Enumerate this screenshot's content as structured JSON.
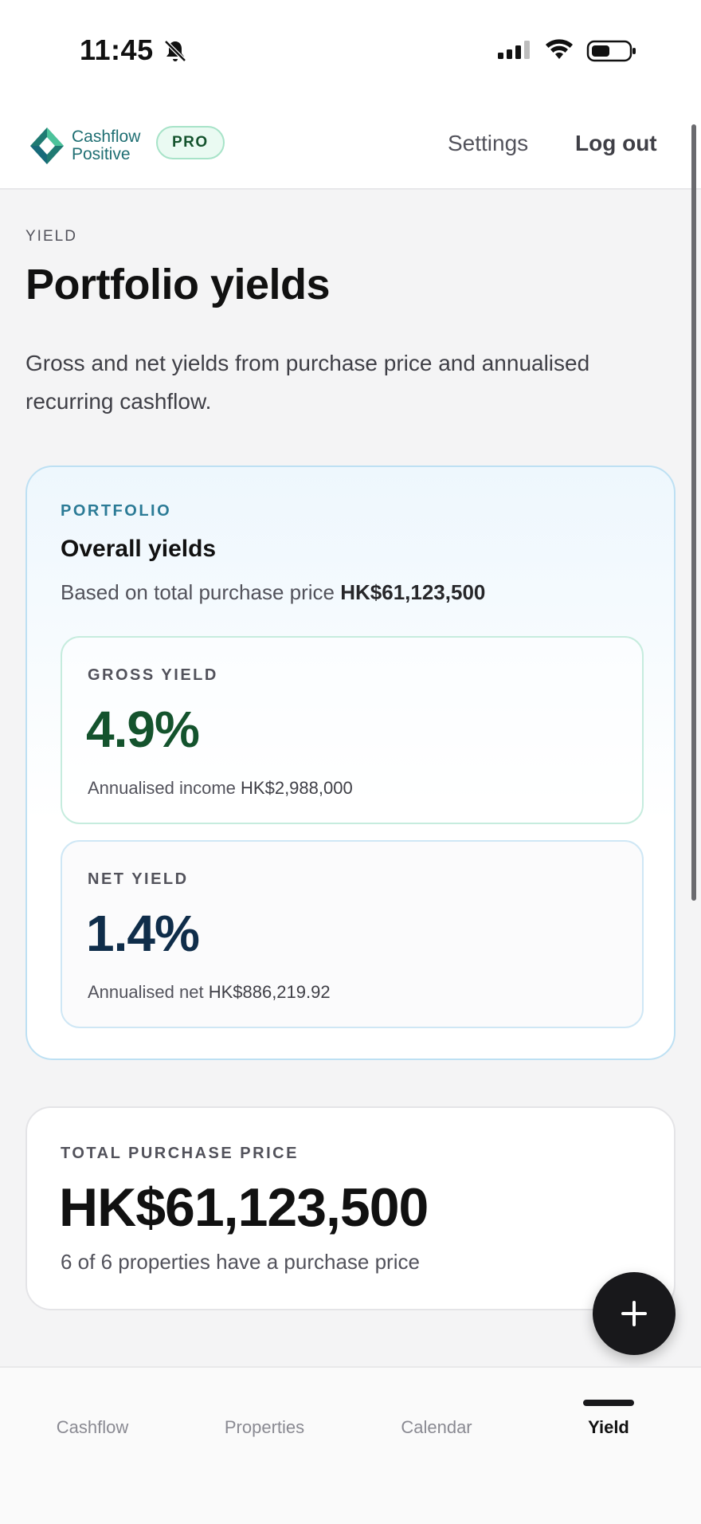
{
  "status_bar": {
    "time": "11:45",
    "icons": [
      "bell-slash-icon",
      "cellular-signal-icon",
      "wifi-icon",
      "battery-icon"
    ]
  },
  "header": {
    "brand_line1": "Cashflow",
    "brand_line2": "Positive",
    "badge": "PRO",
    "settings_label": "Settings",
    "logout_label": "Log out"
  },
  "page": {
    "eyebrow": "YIELD",
    "title": "Portfolio yields",
    "description": "Gross and net yields from purchase price and annualised recurring cashflow."
  },
  "portfolio": {
    "eyebrow": "PORTFOLIO",
    "title": "Overall yields",
    "subtitle_prefix": "Based on total purchase price",
    "subtitle_value": "HK$61,123,500",
    "gross": {
      "label": "GROSS YIELD",
      "value": "4.9%",
      "note_prefix": "Annualised income",
      "note_value": "HK$2,988,000"
    },
    "net": {
      "label": "NET YIELD",
      "value": "1.4%",
      "note_prefix": "Annualised net",
      "note_value": "HK$886,219.92"
    }
  },
  "total": {
    "label": "TOTAL PURCHASE PRICE",
    "value": "HK$61,123,500",
    "note": "6 of 6 properties have a purchase price"
  },
  "fab": {
    "icon": "plus-icon"
  },
  "bottom_nav": {
    "items": [
      {
        "label": "Cashflow",
        "active": false
      },
      {
        "label": "Properties",
        "active": false
      },
      {
        "label": "Calendar",
        "active": false
      },
      {
        "label": "Yield",
        "active": true
      }
    ]
  },
  "colors": {
    "accent_teal": "#2b7b96",
    "gross_green": "#14532d",
    "net_navy": "#0f2d4a",
    "pro_badge_bg": "#eafaf2"
  }
}
